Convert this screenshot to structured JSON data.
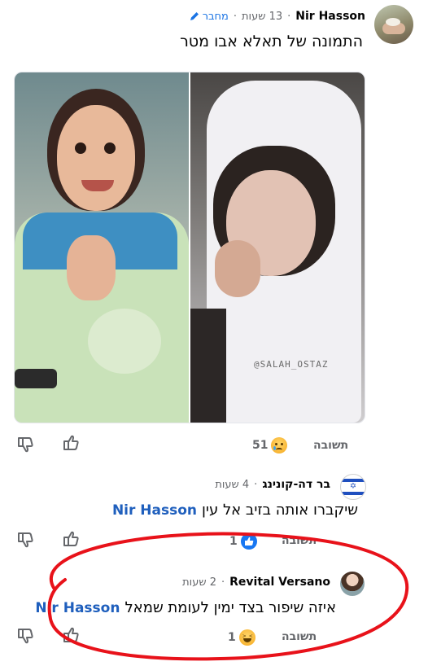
{
  "comments": [
    {
      "author": "Nir Hasson",
      "time": "13 שעות",
      "badge": "מחבר",
      "text": "התמונה של תאלא אבו מטר",
      "watermark": "@SALAH_OSTAZ",
      "reply_label": "תשובה",
      "reaction_count": "51",
      "reaction_icon": "sad-face-icon"
    },
    {
      "author": "בר דה-קונינג",
      "time": "4 שעות",
      "mention": "Nir Hasson",
      "text": "שיקברו אותה בזיב אל עין",
      "reply_label": "תשובה",
      "reaction_count": "1",
      "reaction_icon": "like-reaction-icon"
    },
    {
      "author": "Revital Versano",
      "time": "2 שעות",
      "mention": "Nir Hasson",
      "text": "איזה שיפור בצד ימין לעומת שמאל",
      "reply_label": "תשובה",
      "reaction_count": "1",
      "reaction_icon": "laughing-face-icon"
    }
  ],
  "colors": {
    "highlight_circle": "#e8121a",
    "mention": "#1f5fbd",
    "meta": "#65676b"
  }
}
